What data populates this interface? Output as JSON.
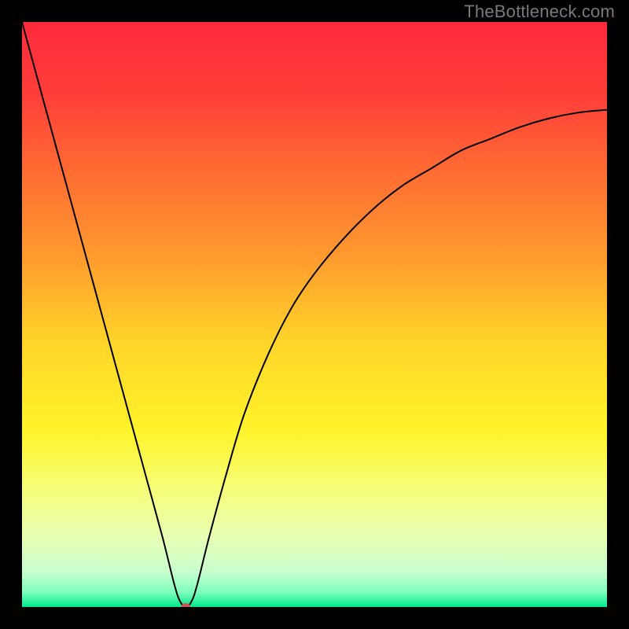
{
  "watermark": "TheBottleneck.com",
  "chart_data": {
    "type": "line",
    "title": "",
    "xlabel": "",
    "ylabel": "",
    "xlim": [
      0,
      100
    ],
    "ylim": [
      0,
      100
    ],
    "grid": false,
    "legend": false,
    "background": {
      "type": "vertical-gradient",
      "stops": [
        {
          "offset": 0.0,
          "color": "#ff2a3c"
        },
        {
          "offset": 0.12,
          "color": "#ff3d3a"
        },
        {
          "offset": 0.25,
          "color": "#ff6a33"
        },
        {
          "offset": 0.4,
          "color": "#ff9a2e"
        },
        {
          "offset": 0.55,
          "color": "#ffd629"
        },
        {
          "offset": 0.7,
          "color": "#fff32a"
        },
        {
          "offset": 0.8,
          "color": "#f6ff7a"
        },
        {
          "offset": 0.88,
          "color": "#e8ffb3"
        },
        {
          "offset": 0.94,
          "color": "#c8ffcf"
        },
        {
          "offset": 0.975,
          "color": "#7dffbb"
        },
        {
          "offset": 1.0,
          "color": "#00e98f"
        }
      ]
    },
    "series": [
      {
        "name": "bottleneck-curve",
        "color": "#000000",
        "width": 2,
        "x": [
          0,
          3,
          6,
          9,
          12,
          15,
          18,
          21,
          24,
          26,
          27,
          28,
          29,
          30,
          32,
          35,
          38,
          42,
          46,
          50,
          55,
          60,
          65,
          70,
          75,
          80,
          85,
          90,
          95,
          100
        ],
        "y": [
          100,
          89,
          78,
          67,
          56,
          45,
          34,
          23,
          12,
          4,
          1,
          0,
          1,
          4,
          12,
          23,
          33,
          43,
          51,
          57,
          63,
          68,
          72,
          75,
          78,
          80,
          82,
          83.5,
          84.5,
          85
        ]
      }
    ],
    "marker": {
      "name": "optimal-point",
      "x": 28,
      "y": 0,
      "rx": 6,
      "ry": 5,
      "color": "#c85a52"
    }
  }
}
